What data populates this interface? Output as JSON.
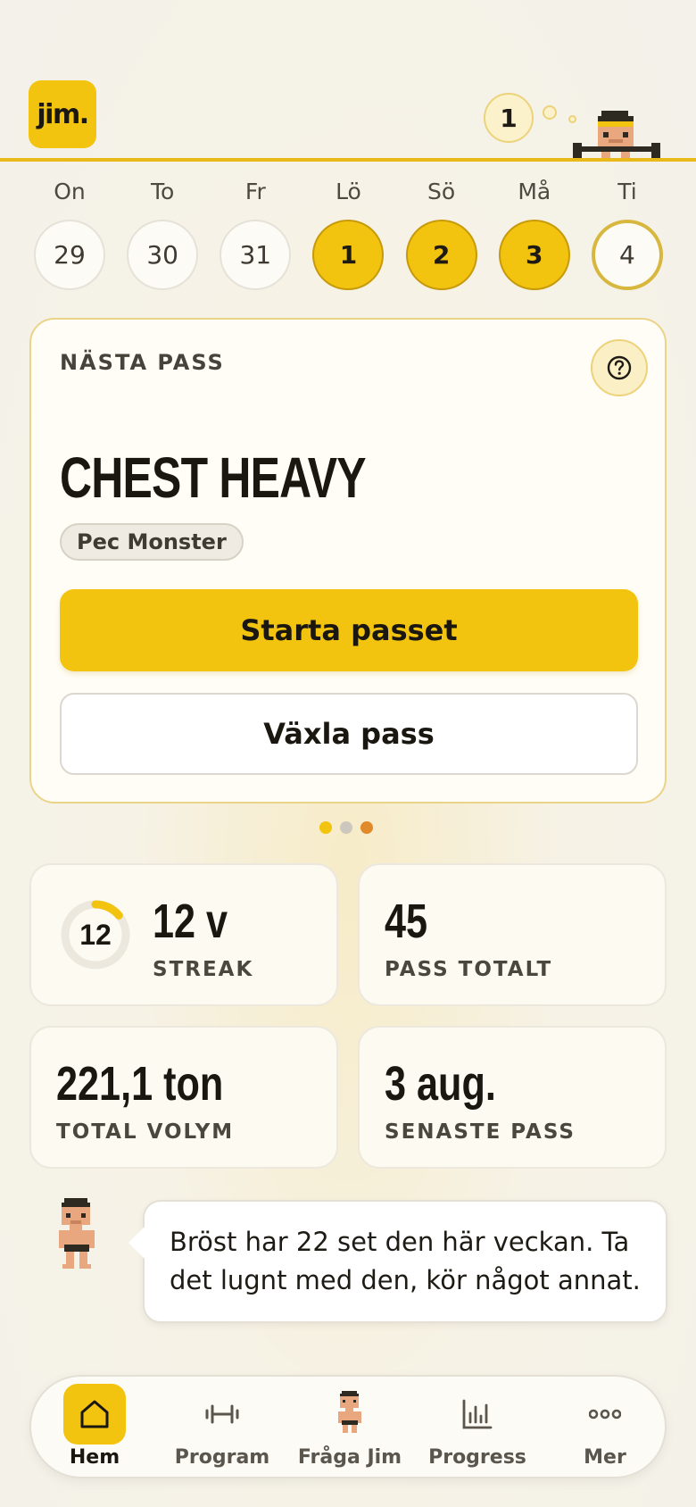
{
  "app": {
    "logo_text": "jim.",
    "bubble_count": "1"
  },
  "week": {
    "days": [
      {
        "label": "On",
        "date": "29",
        "state": "normal"
      },
      {
        "label": "To",
        "date": "30",
        "state": "normal"
      },
      {
        "label": "Fr",
        "date": "31",
        "state": "normal"
      },
      {
        "label": "Lö",
        "date": "1",
        "state": "done"
      },
      {
        "label": "Sö",
        "date": "2",
        "state": "done"
      },
      {
        "label": "Må",
        "date": "3",
        "state": "done"
      },
      {
        "label": "Ti",
        "date": "4",
        "state": "today"
      }
    ]
  },
  "next_workout": {
    "eyebrow": "NÄSTA PASS",
    "title": "CHEST HEAVY",
    "program": "Pec Monster",
    "start_label": "Starta passet",
    "switch_label": "Växla pass"
  },
  "pager": {
    "count": 3,
    "active_index": 0,
    "colors": [
      "#f2c30f",
      "#cdc8bd",
      "#e08a2a"
    ]
  },
  "stats": {
    "streak": {
      "ring_number": "12",
      "value": "12 v",
      "label": "STREAK",
      "ring_progress": 0.14
    },
    "total_sessions": {
      "value": "45",
      "label": "PASS TOTALT"
    },
    "total_volume": {
      "value": "221,1 ton",
      "label": "TOTAL VOLYM"
    },
    "last_session": {
      "value": "3 aug.",
      "label": "SENASTE PASS"
    }
  },
  "jim_tip": {
    "text": "Bröst har 22 set den här veckan. Ta det lugnt med den, kör något annat."
  },
  "nav": {
    "items": [
      {
        "label": "Hem",
        "icon": "home-icon",
        "active": true
      },
      {
        "label": "Program",
        "icon": "dumbbell-icon",
        "active": false
      },
      {
        "label": "Fråga Jim",
        "icon": "jim-avatar-icon",
        "active": false
      },
      {
        "label": "Progress",
        "icon": "bar-chart-icon",
        "active": false
      },
      {
        "label": "Mer",
        "icon": "more-icon",
        "active": false
      }
    ]
  },
  "colors": {
    "accent": "#f2c30f",
    "accent_border": "#ead48a"
  }
}
